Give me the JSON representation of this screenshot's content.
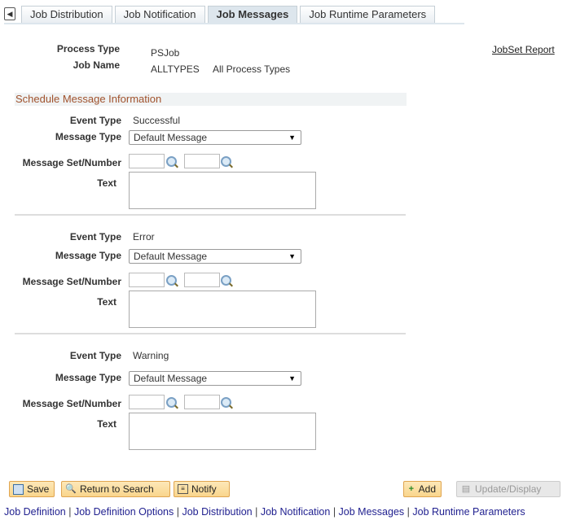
{
  "tabs": [
    {
      "label": "Job Distribution",
      "active": false
    },
    {
      "label": "Job Notification",
      "active": false
    },
    {
      "label": "Job Messages",
      "active": true
    },
    {
      "label": "Job Runtime Parameters",
      "active": false
    }
  ],
  "header": {
    "process_type_label": "Process Type",
    "process_type": "PSJob",
    "job_name_label": "Job Name",
    "job_name": "ALLTYPES",
    "job_desc": "All Process Types",
    "jobset_report": "JobSet Report"
  },
  "section_title": "Schedule Message Information",
  "labels": {
    "event_type": "Event Type",
    "message_type": "Message Type",
    "message_set": "Message Set/Number",
    "text": "Text"
  },
  "messages": [
    {
      "event_type": "Successful",
      "message_type": "Default Message",
      "set": "",
      "number": "",
      "text": ""
    },
    {
      "event_type": "Error",
      "message_type": "Default Message",
      "set": "",
      "number": "",
      "text": ""
    },
    {
      "event_type": "Warning",
      "message_type": "Default Message",
      "set": "",
      "number": "",
      "text": ""
    }
  ],
  "buttons": {
    "save": "Save",
    "return": "Return to Search",
    "notify": "Notify",
    "add": "Add",
    "update": "Update/Display"
  },
  "links": [
    "Job Definition",
    "Job Definition Options",
    "Job Distribution",
    "Job Notification",
    "Job Messages",
    "Job Runtime Parameters"
  ],
  "colors": {
    "section_title": "#a0522d",
    "button": "#f9d58c",
    "link": "#1f1f8f"
  }
}
